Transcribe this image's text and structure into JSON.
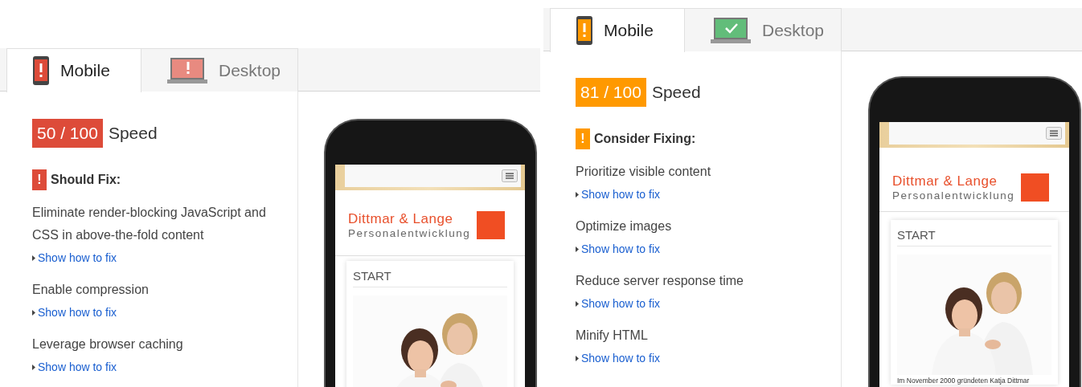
{
  "panels": [
    {
      "tabs": [
        {
          "label": "Mobile",
          "kind": "phone",
          "color": "#dd4b39",
          "passed": false,
          "selected": true
        },
        {
          "label": "Desktop",
          "kind": "laptop",
          "color": "#e88a80",
          "passed": false,
          "selected": false
        }
      ],
      "score": {
        "value": "50 / 100",
        "label": "Speed",
        "color": "#dd4b39"
      },
      "section": {
        "marker": "!",
        "title": "Should Fix:",
        "color": "#dd4b39"
      },
      "issues": [
        {
          "title": "Eliminate render-blocking JavaScript and CSS in above-the-fold content",
          "link": "Show how to fix"
        },
        {
          "title": "Enable compression",
          "link": "Show how to fix"
        },
        {
          "title": "Leverage browser caching",
          "link": "Show how to fix"
        }
      ],
      "preview": {
        "brand": "Dittmar & Lange",
        "tagline": "Personalentwicklung",
        "heading": "START"
      }
    },
    {
      "tabs": [
        {
          "label": "Mobile",
          "kind": "phone",
          "color": "#ff9900",
          "passed": false,
          "selected": true
        },
        {
          "label": "Desktop",
          "kind": "laptop",
          "color": "#62bd7a",
          "passed": true,
          "selected": false
        }
      ],
      "score": {
        "value": "81 / 100",
        "label": "Speed",
        "color": "#ff9900"
      },
      "section": {
        "marker": "!",
        "title": "Consider Fixing:",
        "color": "#ff9900"
      },
      "issues": [
        {
          "title": "Prioritize visible content",
          "link": "Show how to fix"
        },
        {
          "title": "Optimize images",
          "link": "Show how to fix"
        },
        {
          "title": "Reduce server response time",
          "link": "Show how to fix"
        },
        {
          "title": "Minify HTML",
          "link": "Show how to fix"
        }
      ],
      "preview": {
        "brand": "Dittmar & Lange",
        "tagline": "Personalentwicklung",
        "heading": "START",
        "caption": "Im November 2000 gründeten Katja Dittmar"
      }
    }
  ]
}
